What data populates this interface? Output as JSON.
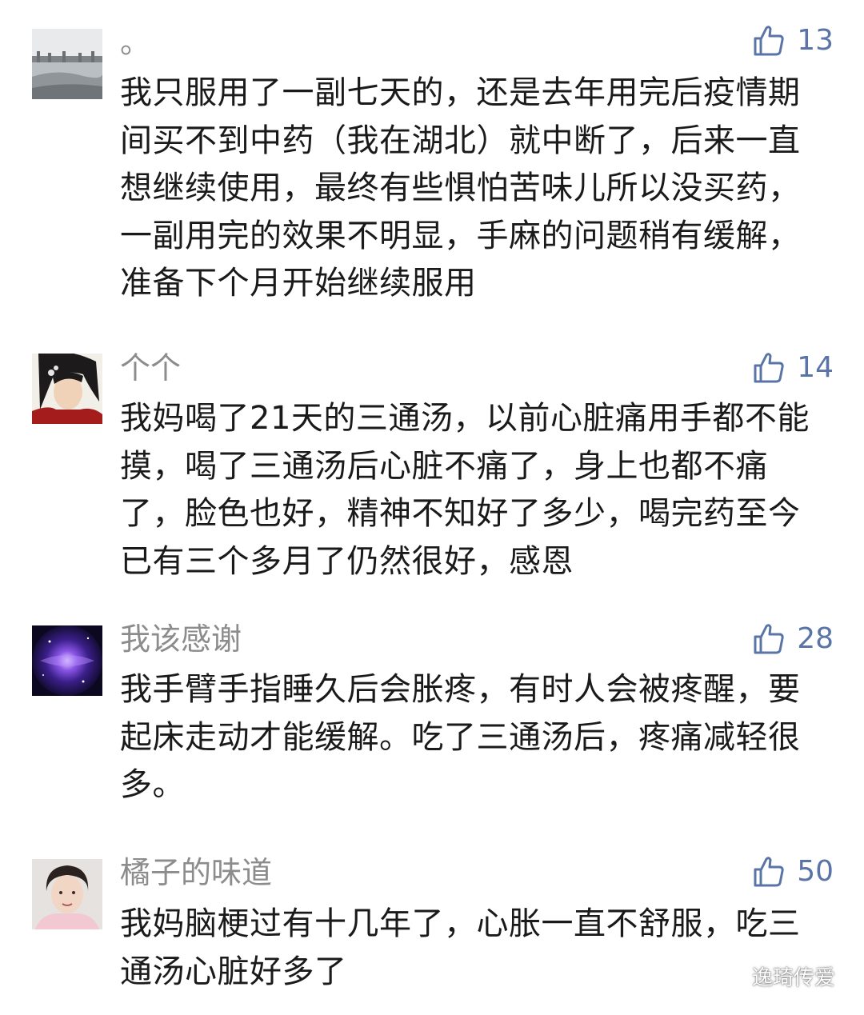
{
  "comments": [
    {
      "nickname": "。",
      "likes": "13",
      "avatar_icon": "lake-scenery-avatar",
      "text": "我只服用了一副七天的，还是去年用完后疫情期间买不到中药（我在湖北）就中断了，后来一直想继续使用，最终有些惧怕苦味儿所以没买药，一副用完的效果不明显，手麻的问题稍有缓解，准备下个月开始继续服用"
    },
    {
      "nickname": "个个",
      "likes": "14",
      "avatar_icon": "woman-portrait-avatar",
      "text": "我妈喝了21天的三通汤，以前心脏痛用手都不能摸，喝了三通汤后心脏不痛了，身上也都不痛了，脸色也好，精神不知好了多少，喝完药至今已有三个多月了仍然很好，感恩"
    },
    {
      "nickname": "我该感谢",
      "likes": "28",
      "avatar_icon": "galaxy-avatar",
      "text": "我手臂手指睡久后会胀疼，有时人会被疼醒，要起床走动才能缓解。吃了三通汤后，疼痛减轻很多。"
    },
    {
      "nickname": "橘子的味道",
      "likes": "50",
      "avatar_icon": "person-photo-avatar",
      "text": "我妈脑梗过有十几年了，心胀一直不舒服，吃三通汤心脏好多了"
    }
  ],
  "watermark": {
    "text": "逸琦传爱",
    "icon": "wechat-icon"
  },
  "colors": {
    "like": "#5b74a8",
    "nickname": "#8c8c8c",
    "text": "#1a1a1a"
  }
}
